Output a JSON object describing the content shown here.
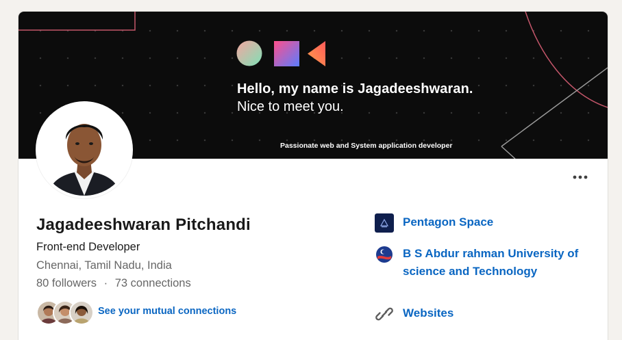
{
  "banner": {
    "greeting": "Hello, my name is Jagadeeshwaran.",
    "greeting_line2": "Nice to meet you.",
    "tagline": "Passionate web and System application developer"
  },
  "profile": {
    "name": "Jagadeeshwaran Pitchandi",
    "headline": "Front-end Developer",
    "location": "Chennai, Tamil Nadu, India",
    "followers": "80 followers",
    "separator": "·",
    "connections": "73 connections",
    "mutual_link": "See your mutual connections"
  },
  "side": {
    "company": "Pentagon Space",
    "school_line1": "B S Abdur rahman University of",
    "school_line2": "science and Technology",
    "websites": "Websites"
  },
  "menu": {
    "more_icon": "more-horizontal-icon"
  },
  "colors": {
    "link": "#0a66c2",
    "banner_bg": "#0c0c0c",
    "text": "#191919",
    "muted": "#666666"
  }
}
